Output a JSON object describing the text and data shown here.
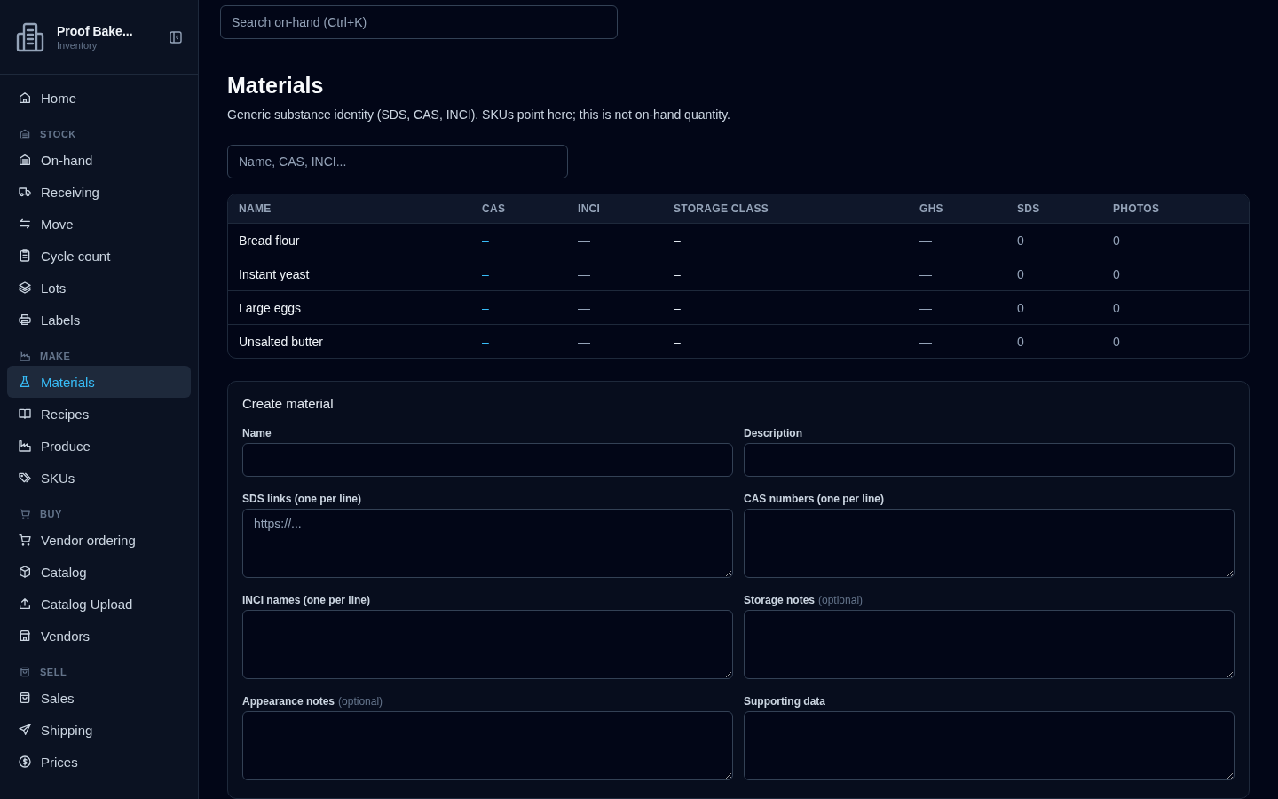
{
  "brand": {
    "name": "Proof Bake...",
    "subtitle": "Inventory"
  },
  "sidebar": {
    "items": [
      {
        "label": "Home",
        "selected": false
      }
    ],
    "sections": [
      {
        "heading": "STOCK",
        "items": [
          {
            "label": "On-hand",
            "selected": false
          },
          {
            "label": "Receiving",
            "selected": false
          },
          {
            "label": "Move",
            "selected": false
          },
          {
            "label": "Cycle count",
            "selected": false
          },
          {
            "label": "Lots",
            "selected": false
          },
          {
            "label": "Labels",
            "selected": false
          }
        ]
      },
      {
        "heading": "MAKE",
        "items": [
          {
            "label": "Materials",
            "selected": true
          },
          {
            "label": "Recipes",
            "selected": false
          },
          {
            "label": "Produce",
            "selected": false
          },
          {
            "label": "SKUs",
            "selected": false
          }
        ]
      },
      {
        "heading": "BUY",
        "items": [
          {
            "label": "Vendor ordering",
            "selected": false
          },
          {
            "label": "Catalog",
            "selected": false
          },
          {
            "label": "Catalog Upload",
            "selected": false
          },
          {
            "label": "Vendors",
            "selected": false
          }
        ]
      },
      {
        "heading": "SELL",
        "items": [
          {
            "label": "Sales",
            "selected": false
          },
          {
            "label": "Shipping",
            "selected": false
          },
          {
            "label": "Prices",
            "selected": false
          }
        ]
      }
    ]
  },
  "search": {
    "placeholder": "Search on-hand (Ctrl+K)"
  },
  "page": {
    "title": "Materials",
    "description": "Generic substance identity (SDS, CAS, INCI). SKUs point here; this is not on-hand quantity."
  },
  "filter": {
    "placeholder": "Name, CAS, INCI..."
  },
  "table": {
    "columns": [
      "NAME",
      "CAS",
      "INCI",
      "STORAGE CLASS",
      "GHS",
      "SDS",
      "PHOTOS"
    ],
    "rows": [
      {
        "cells": [
          {
            "text": "Bread flour",
            "kind": "name"
          },
          {
            "text": "–",
            "kind": "link"
          },
          {
            "text": "—",
            "kind": "muted"
          },
          {
            "text": "–",
            "kind": "plain"
          },
          {
            "text": "—",
            "kind": "muted"
          },
          {
            "text": "0",
            "kind": "muted"
          },
          {
            "text": "0",
            "kind": "muted"
          }
        ]
      },
      {
        "cells": [
          {
            "text": "Instant yeast",
            "kind": "name"
          },
          {
            "text": "–",
            "kind": "link"
          },
          {
            "text": "—",
            "kind": "muted"
          },
          {
            "text": "–",
            "kind": "plain"
          },
          {
            "text": "—",
            "kind": "muted"
          },
          {
            "text": "0",
            "kind": "muted"
          },
          {
            "text": "0",
            "kind": "muted"
          }
        ]
      },
      {
        "cells": [
          {
            "text": "Large eggs",
            "kind": "name"
          },
          {
            "text": "–",
            "kind": "link"
          },
          {
            "text": "—",
            "kind": "muted"
          },
          {
            "text": "–",
            "kind": "plain"
          },
          {
            "text": "—",
            "kind": "muted"
          },
          {
            "text": "0",
            "kind": "muted"
          },
          {
            "text": "0",
            "kind": "muted"
          }
        ]
      },
      {
        "cells": [
          {
            "text": "Unsalted butter",
            "kind": "name"
          },
          {
            "text": "–",
            "kind": "link"
          },
          {
            "text": "—",
            "kind": "muted"
          },
          {
            "text": "–",
            "kind": "plain"
          },
          {
            "text": "—",
            "kind": "muted"
          },
          {
            "text": "0",
            "kind": "muted"
          },
          {
            "text": "0",
            "kind": "muted"
          }
        ]
      }
    ]
  },
  "form": {
    "title": "Create material",
    "fields": [
      {
        "label": "Name",
        "kind": "input"
      },
      {
        "label": "Description",
        "kind": "input"
      },
      {
        "label": "SDS links (one per line)",
        "kind": "textarea",
        "placeholder": "https://..."
      },
      {
        "label": "CAS numbers (one per line)",
        "kind": "textarea"
      },
      {
        "label": "INCI names (one per line)",
        "kind": "textarea"
      },
      {
        "label": "Storage notes",
        "note": "(optional)",
        "kind": "textarea"
      },
      {
        "label": "Appearance notes",
        "note": "(optional)",
        "kind": "textarea"
      },
      {
        "label": "Supporting data",
        "kind": "textarea"
      }
    ]
  }
}
